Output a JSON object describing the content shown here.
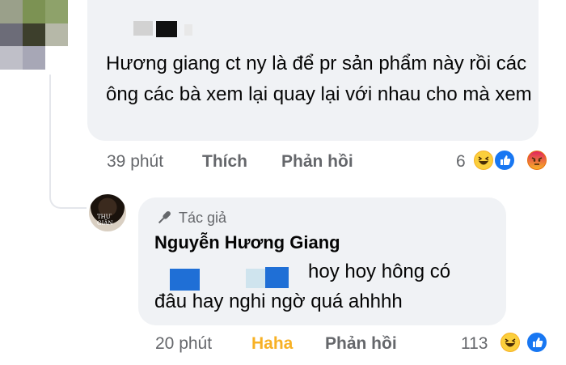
{
  "comment1": {
    "text": "Hương giang ct ny là để pr sản phẩm này rồi các ông các bà xem lại quay lại với nhau cho mà xem",
    "time": "39 phút",
    "like_label": "Thích",
    "reply_label": "Phản hồi",
    "reaction_count": "6",
    "reactions": [
      "haha-icon",
      "like-icon",
      "angry-icon"
    ]
  },
  "comment2": {
    "badge": "Tác giả",
    "author": "Nguyễn Hương Giang",
    "text_line1": "hoy hoy hông có",
    "text_line2": "đâu hay nghi ngờ quá ahhhh",
    "time": "20 phút",
    "react_label": "Haha",
    "reply_label": "Phản hồi",
    "reaction_count": "113",
    "reactions": [
      "haha-icon",
      "like-icon"
    ],
    "avatar_text": "THƯ GIÃN"
  },
  "colors": {
    "bubble": "#f0f2f5",
    "meta": "#65676b",
    "haha_active": "#f7b125",
    "like_blue": "#1877f2",
    "angry_red": "#e9710f"
  }
}
